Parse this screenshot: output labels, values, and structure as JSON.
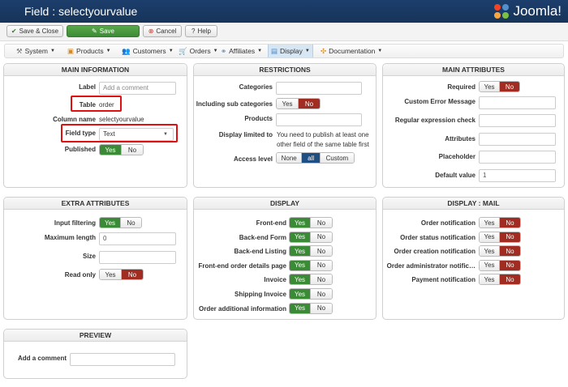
{
  "header": {
    "title": "Field : selectyourvalue",
    "brand": "Joomla!"
  },
  "toolbar": {
    "save_close": "Save & Close",
    "save": "Save",
    "cancel": "Cancel",
    "help": "Help"
  },
  "menu": [
    {
      "label": "System"
    },
    {
      "label": "Products"
    },
    {
      "label": "Customers"
    },
    {
      "label": "Orders"
    },
    {
      "label": "Affiliates"
    },
    {
      "label": "Display"
    },
    {
      "label": "Documentation"
    }
  ],
  "main_info": {
    "heading": "MAIN INFORMATION",
    "label_label": "Label",
    "label_placeholder": "Add a comment",
    "table_label": "Table",
    "table_value": "order",
    "column_label": "Column name",
    "column_value": "selectyourvalue",
    "fieldtype_label": "Field type",
    "fieldtype_value": "Text",
    "published_label": "Published",
    "yes": "Yes",
    "no": "No"
  },
  "restrictions": {
    "heading": "RESTRICTIONS",
    "categories": "Categories",
    "sub_categories": "Including sub categories",
    "products": "Products",
    "display_limited": "Display limited to",
    "display_limited_msg1": "You need to publish at least one",
    "display_limited_msg2": "other field of the same  table first",
    "access_level": "Access level",
    "access_none": "None",
    "access_all": "all",
    "access_custom": "Custom",
    "yes": "Yes",
    "no": "No"
  },
  "main_attr": {
    "heading": "MAIN ATTRIBUTES",
    "required": "Required",
    "custom_error": "Custom Error Message",
    "regex": "Regular expression check",
    "attributes": "Attributes",
    "placeholder": "Placeholder",
    "default_value": "Default value",
    "default_value_val": "1",
    "yes": "Yes",
    "no": "No"
  },
  "extra_attr": {
    "heading": "EXTRA ATTRIBUTES",
    "input_filtering": "Input filtering",
    "max_length": "Maximum length",
    "max_length_val": "0",
    "size": "Size",
    "read_only": "Read only",
    "yes": "Yes",
    "no": "No"
  },
  "display": {
    "heading": "DISPLAY",
    "rows": [
      "Front-end",
      "Back-end Form",
      "Back-end Listing",
      "Front-end order details page",
      "Invoice",
      "Shipping Invoice",
      "Order additional information"
    ],
    "yes": "Yes",
    "no": "No"
  },
  "display_mail": {
    "heading": "DISPLAY : MAIL",
    "rows": [
      "Order notification",
      "Order status notification",
      "Order creation notification",
      "Order administrator notific…",
      "Payment notification"
    ],
    "yes": "Yes",
    "no": "No"
  },
  "preview": {
    "heading": "PREVIEW",
    "add_comment": "Add a comment"
  }
}
